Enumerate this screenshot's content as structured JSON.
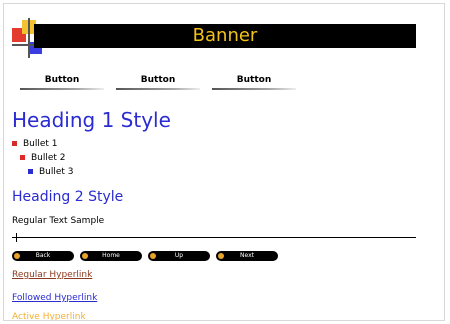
{
  "banner": {
    "title": "Banner"
  },
  "nav": {
    "buttons": [
      "Button",
      "Button",
      "Button"
    ]
  },
  "heading1": "Heading 1 Style",
  "bullets": [
    {
      "text": "Bullet 1",
      "marker_color": "#d32a2a"
    },
    {
      "text": "Bullet 2",
      "marker_color": "#e02a2a"
    },
    {
      "text": "Bullet 3",
      "marker_color": "#2a2bd0"
    }
  ],
  "heading2": "Heading 2 Style",
  "regular_text": "Regular Text Sample",
  "pill_buttons": [
    "Back",
    "Home",
    "Up",
    "Next"
  ],
  "links": {
    "regular": "Regular Hyperlink",
    "followed": "Followed Hyperlink",
    "active": "Active Hyperlink"
  },
  "colors": {
    "banner_bg": "#000000",
    "banner_text": "#f3c21a",
    "heading": "#2a2bd0",
    "link_regular": "#8b3a1e",
    "link_followed": "#2a2bd0",
    "link_active": "#f0b032"
  }
}
